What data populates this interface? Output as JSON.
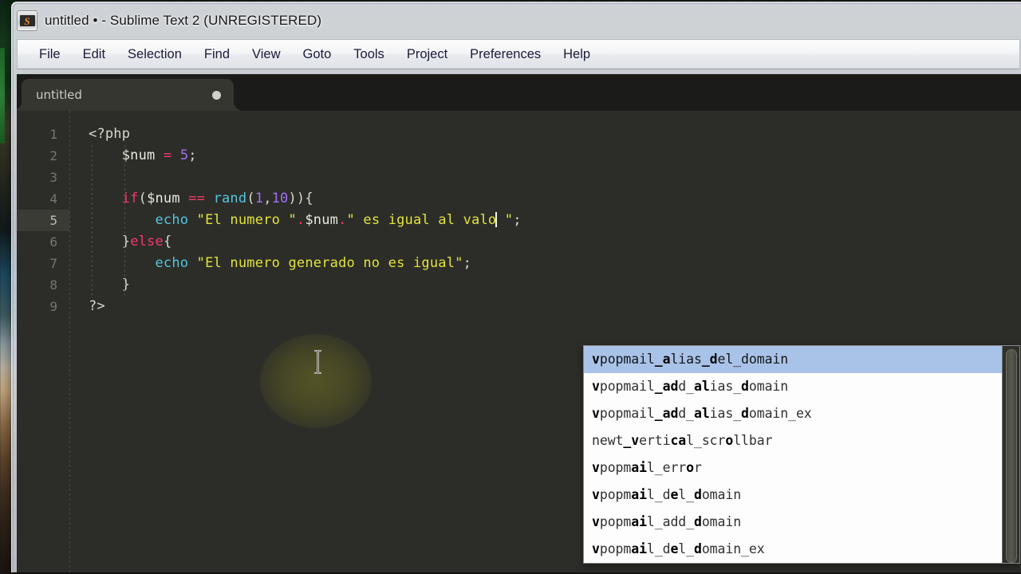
{
  "window": {
    "title": "untitled • - Sublime Text 2 (UNREGISTERED)",
    "app_icon": "sublime-text-icon",
    "icon_glyph": "S"
  },
  "menubar": {
    "items": [
      {
        "label": "File"
      },
      {
        "label": "Edit"
      },
      {
        "label": "Selection"
      },
      {
        "label": "Find"
      },
      {
        "label": "View"
      },
      {
        "label": "Goto"
      },
      {
        "label": "Tools"
      },
      {
        "label": "Project"
      },
      {
        "label": "Preferences"
      },
      {
        "label": "Help"
      }
    ]
  },
  "tabs": [
    {
      "label": "untitled",
      "dirty": true
    }
  ],
  "editor": {
    "active_line": 5,
    "line_numbers": [
      "1",
      "2",
      "3",
      "4",
      "5",
      "6",
      "7",
      "8",
      "9"
    ],
    "lines": [
      {
        "n": "1",
        "tokens": [
          {
            "t": "<?php",
            "c": "tok-tag"
          }
        ]
      },
      {
        "n": "2",
        "tokens": [
          {
            "t": "    ",
            "c": "tok-plain"
          },
          {
            "t": "$num",
            "c": "tok-var"
          },
          {
            "t": " ",
            "c": "tok-plain"
          },
          {
            "t": "=",
            "c": "tok-op"
          },
          {
            "t": " ",
            "c": "tok-plain"
          },
          {
            "t": "5",
            "c": "tok-num"
          },
          {
            "t": ";",
            "c": "tok-punct"
          }
        ]
      },
      {
        "n": "3",
        "tokens": []
      },
      {
        "n": "4",
        "tokens": [
          {
            "t": "    ",
            "c": "tok-plain"
          },
          {
            "t": "if",
            "c": "tok-kw"
          },
          {
            "t": "(",
            "c": "tok-punct"
          },
          {
            "t": "$num",
            "c": "tok-var"
          },
          {
            "t": " ",
            "c": "tok-plain"
          },
          {
            "t": "==",
            "c": "tok-op"
          },
          {
            "t": " ",
            "c": "tok-plain"
          },
          {
            "t": "rand",
            "c": "tok-fn"
          },
          {
            "t": "(",
            "c": "tok-punct"
          },
          {
            "t": "1",
            "c": "tok-num"
          },
          {
            "t": ",",
            "c": "tok-punct"
          },
          {
            "t": "10",
            "c": "tok-num"
          },
          {
            "t": ")){",
            "c": "tok-punct"
          }
        ]
      },
      {
        "n": "5",
        "tokens": [
          {
            "t": "        ",
            "c": "tok-plain"
          },
          {
            "t": "echo",
            "c": "tok-fn"
          },
          {
            "t": " ",
            "c": "tok-plain"
          },
          {
            "t": "\"El numero \"",
            "c": "tok-str"
          },
          {
            "t": ".",
            "c": "tok-op"
          },
          {
            "t": "$num",
            "c": "tok-var"
          },
          {
            "t": ".",
            "c": "tok-op"
          },
          {
            "t": "\" es igual al valo",
            "c": "tok-str"
          },
          {
            "t": "CARET",
            "c": "caret"
          },
          {
            "t": " \"",
            "c": "tok-str"
          },
          {
            "t": ";",
            "c": "tok-punct"
          }
        ]
      },
      {
        "n": "6",
        "tokens": [
          {
            "t": "    ",
            "c": "tok-plain"
          },
          {
            "t": "}",
            "c": "tok-punct"
          },
          {
            "t": "else",
            "c": "tok-kw"
          },
          {
            "t": "{",
            "c": "tok-punct"
          }
        ]
      },
      {
        "n": "7",
        "tokens": [
          {
            "t": "        ",
            "c": "tok-plain"
          },
          {
            "t": "echo",
            "c": "tok-fn"
          },
          {
            "t": " ",
            "c": "tok-plain"
          },
          {
            "t": "\"El numero generado no es igual\"",
            "c": "tok-str"
          },
          {
            "t": ";",
            "c": "tok-punct"
          }
        ]
      },
      {
        "n": "8",
        "tokens": [
          {
            "t": "    ",
            "c": "tok-plain"
          },
          {
            "t": "}",
            "c": "tok-punct"
          }
        ]
      },
      {
        "n": "9",
        "tokens": [
          {
            "t": "?>",
            "c": "tok-tag"
          }
        ]
      }
    ],
    "source_text": [
      "<?php",
      "    $num = 5;",
      "",
      "    if($num == rand(1,10)){",
      "        echo \"El numero \".$num.\" es igual al valo \";",
      "    }else{",
      "        echo \"El numero generado no es igual\";",
      "    }",
      "?>"
    ]
  },
  "autocomplete": {
    "selected_index": 0,
    "items": [
      {
        "text": "vpopmail_alias_del_domain",
        "bold": [
          0,
          8,
          9,
          14,
          15
        ]
      },
      {
        "text": "vpopmail_add_alias_domain",
        "bold": [
          0,
          8,
          9,
          10,
          13,
          14,
          19
        ]
      },
      {
        "text": "vpopmail_add_alias_domain_ex",
        "bold": [
          0,
          8,
          9,
          10,
          13,
          14,
          19
        ]
      },
      {
        "text": "newt_vertical_scrollbar",
        "bold": [
          4,
          5,
          10,
          11,
          17
        ]
      },
      {
        "text": "vpopmail_error",
        "bold": [
          0,
          5,
          6,
          12
        ]
      },
      {
        "text": "vpopmail_del_domain",
        "bold": [
          0,
          5,
          6,
          10,
          13
        ]
      },
      {
        "text": "vpopmail_add_domain",
        "bold": [
          0,
          5,
          6,
          13
        ]
      },
      {
        "text": "vpopmail_del_domain_ex",
        "bold": [
          0,
          5,
          6,
          10,
          13
        ]
      }
    ]
  },
  "colors": {
    "editor_bg": "#2c2d28",
    "tabbar_bg": "#1b1c19",
    "active_tab_bg": "#35362f",
    "string": "#e2e33c",
    "keyword": "#f6386d",
    "function": "#52c5e0",
    "number": "#a071f0",
    "variable": "#e8e9dd",
    "gutter_text": "#75776c",
    "popup_selection": "#a9c3e8",
    "popup_bg": "#fdfdfd"
  }
}
